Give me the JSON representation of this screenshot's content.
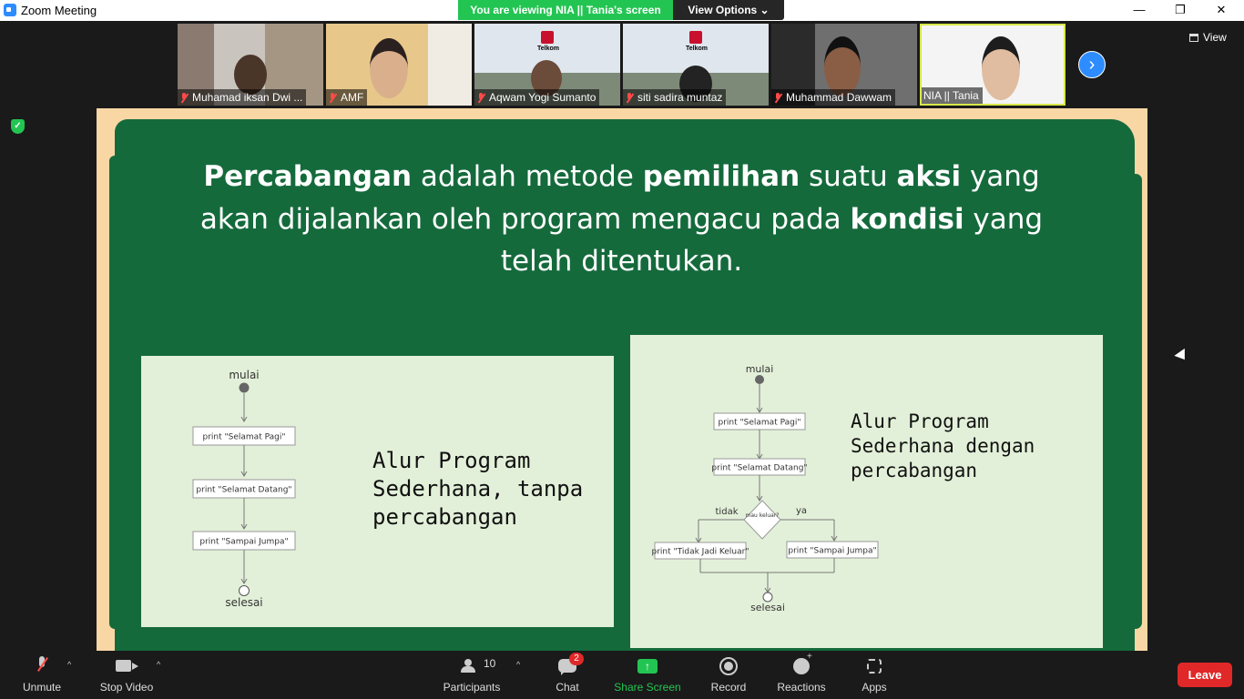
{
  "window": {
    "title": "Zoom Meeting",
    "minimize_glyph": "—",
    "restore_glyph": "❐",
    "close_glyph": "✕"
  },
  "share_banner": {
    "text": "You are viewing NIA || Tania's screen",
    "view_options": "View Options ⌄"
  },
  "participants": [
    {
      "name": "Muhamad iksan Dwi ...",
      "muted": true
    },
    {
      "name": "AMF",
      "muted": true
    },
    {
      "name": "Aqwam Yogi Sumanto",
      "muted": true
    },
    {
      "name": "siti sadira muntaz",
      "muted": true
    },
    {
      "name": "Muhammad Dawwam",
      "muted": true
    },
    {
      "name": "NIA || Tania",
      "muted": false
    }
  ],
  "telkom_logo_text": "Telkom",
  "view_button": "View",
  "next_glyph": "›",
  "shield_glyph": "✓",
  "slide": {
    "text_parts": [
      {
        "t": "Percabangan",
        "bold": true
      },
      {
        "t": " adalah metode ",
        "bold": false
      },
      {
        "t": "pemilihan",
        "bold": true
      },
      {
        "t": " suatu ",
        "bold": false
      },
      {
        "t": "aksi",
        "bold": true
      },
      {
        "t": " yang akan dijalankan oleh program mengacu pada ",
        "bold": false
      },
      {
        "t": "kondisi",
        "bold": true
      },
      {
        "t": " yang telah ditentukan.",
        "bold": false
      }
    ],
    "left_diagram": {
      "start": "mulai",
      "steps": [
        "print \"Selamat Pagi\"",
        "print \"Selamat Datang\"",
        "print \"Sampai Jumpa\""
      ],
      "end": "selesai",
      "caption": "Alur Program Sederhana, tanpa percabangan"
    },
    "right_diagram": {
      "start": "mulai",
      "steps": [
        "print \"Selamat Pagi\"",
        "print \"Selamat Datang\""
      ],
      "decision": "mau keluar?",
      "no_label": "tidak",
      "yes_label": "ya",
      "no_action": "print \"Tidak Jadi Keluar\"",
      "yes_action": "print \"Sampai Jumpa\"",
      "end": "selesai",
      "caption": "Alur Program Sederhana dengan percabangan"
    }
  },
  "toolbar": {
    "unmute": "Unmute",
    "stop_video": "Stop Video",
    "participants": "Participants",
    "participants_count": "10",
    "chat": "Chat",
    "chat_badge": "2",
    "share_screen": "Share Screen",
    "share_glyph": "↑",
    "record": "Record",
    "reactions": "Reactions",
    "apps": "Apps",
    "leave": "Leave",
    "caret_glyph": "^"
  },
  "colors": {
    "board_green": "#156a3c",
    "slide_border": "#f9d7a4",
    "panel_bg": "#e3f0d9",
    "banner_green": "#23c552",
    "leave_red": "#e02828",
    "zoom_blue": "#2d8cff"
  }
}
